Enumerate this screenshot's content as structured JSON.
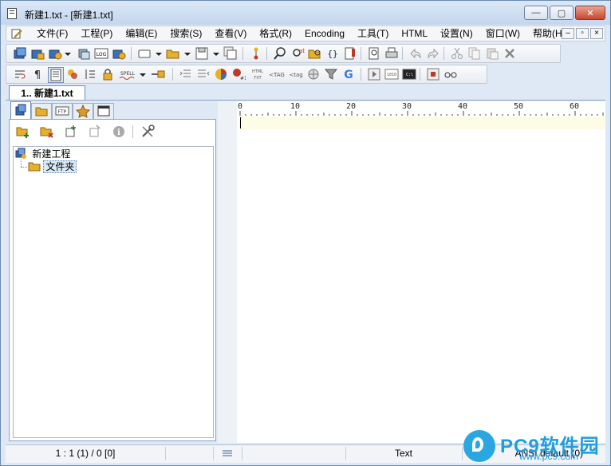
{
  "window": {
    "title": "新建1.txt - [新建1.txt]",
    "controls": {
      "minimize": "—",
      "restore": "▢",
      "close": "✕"
    }
  },
  "menubar": {
    "items": [
      "文件(F)",
      "工程(P)",
      "编辑(E)",
      "搜索(S)",
      "查看(V)",
      "格式(R)",
      "Encoding",
      "工具(T)",
      "HTML",
      "设置(N)",
      "窗口(W)",
      "帮助(H)"
    ],
    "mdi": {
      "minimize": "–",
      "restore": "▫",
      "close": "×"
    }
  },
  "toolbar": {
    "row1_icons": [
      "new-project-icon",
      "open-project-icon",
      "save-project-icon",
      "dropdown-icon",
      "copy-project-icon",
      "log-icon",
      "settings-project-icon",
      "new-file-icon",
      "dropdown-icon",
      "open-file-icon",
      "dropdown-icon",
      "save-icon",
      "dropdown-icon",
      "save-all-icon",
      "tree-icon",
      "find-icon",
      "replace-icon",
      "find-in-files-icon",
      "brackets-icon",
      "bookmark-icon",
      "print-preview-icon",
      "print-icon",
      "undo-icon",
      "redo-icon",
      "cut-icon",
      "copy-icon",
      "paste-icon",
      "delete-icon"
    ],
    "row2_icons": [
      "wrap-icon",
      "pilcrow-icon",
      "text-mode-icon",
      "color-icon",
      "column-icon",
      "lock-icon",
      "spell-icon",
      "dropdown-icon",
      "pin-icon",
      "indent-icon",
      "outdent-icon",
      "chart-icon",
      "ansi-icon",
      "html-txt-icon",
      "tag-icon",
      "tag-lower-icon",
      "web-icon",
      "filter-icon",
      "google-icon",
      "play-icon",
      "binary-icon",
      "console-icon",
      "record-icon",
      "glasses-icon"
    ],
    "spell_label": "SPELL",
    "log_label": "LOG",
    "html_label": "HTML TXT",
    "tag_label": "<tag"
  },
  "document_tabs": [
    {
      "label": "1.. 新建1.txt",
      "active": true
    }
  ],
  "side_panel": {
    "tabs": [
      "project-tab",
      "folder-tab",
      "ftp-tab",
      "favorites-tab",
      "window-tab"
    ],
    "ftp_label": "FTP",
    "tree": [
      {
        "label": "新建工程",
        "level": 0,
        "icon": "project-icon"
      },
      {
        "label": "文件夹",
        "level": 1,
        "icon": "folder-icon",
        "selected": true
      }
    ]
  },
  "editor": {
    "ruler": [
      "0",
      "10",
      "20",
      "30",
      "40",
      "50",
      "60"
    ],
    "content": ""
  },
  "statusbar": {
    "position": "1 : 1 (1) / 0   [0]",
    "mode": "Text",
    "encoding": "ANSI default (0)"
  },
  "watermark": {
    "brand": "PC9软件园",
    "url": "www.pc9.com"
  }
}
